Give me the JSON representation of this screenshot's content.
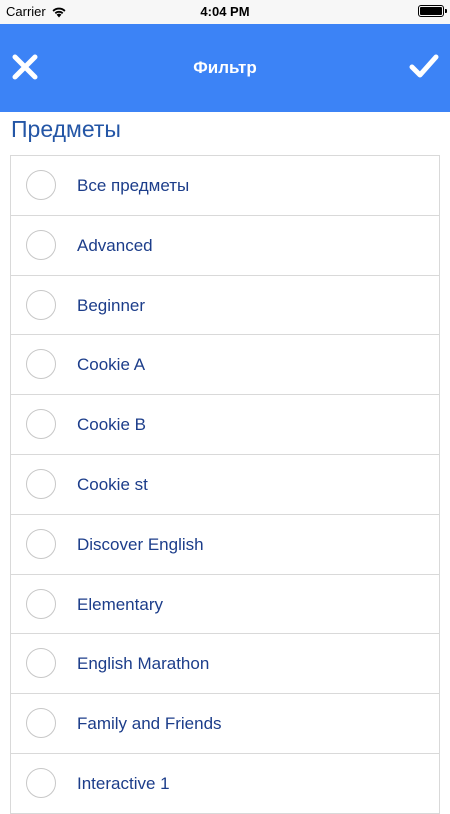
{
  "status_bar": {
    "carrier": "Carrier",
    "time": "4:04 PM",
    "battery_level": 1.0
  },
  "header": {
    "title": "Фильтр",
    "close_icon": "close-icon",
    "confirm_icon": "checkmark-icon",
    "background_color": "#3c83f6"
  },
  "section": {
    "title": "Предметы"
  },
  "list": {
    "items": [
      {
        "label": "Все предметы",
        "selected": false
      },
      {
        "label": "Advanced",
        "selected": false
      },
      {
        "label": "Beginner",
        "selected": false
      },
      {
        "label": "Cookie A",
        "selected": false
      },
      {
        "label": "Cookie B",
        "selected": false
      },
      {
        "label": "Cookie st",
        "selected": false
      },
      {
        "label": "Discover English",
        "selected": false
      },
      {
        "label": "Elementary",
        "selected": false
      },
      {
        "label": "English Marathon",
        "selected": false
      },
      {
        "label": "Family and Friends",
        "selected": false
      },
      {
        "label": "Interactive 1",
        "selected": false
      }
    ]
  }
}
